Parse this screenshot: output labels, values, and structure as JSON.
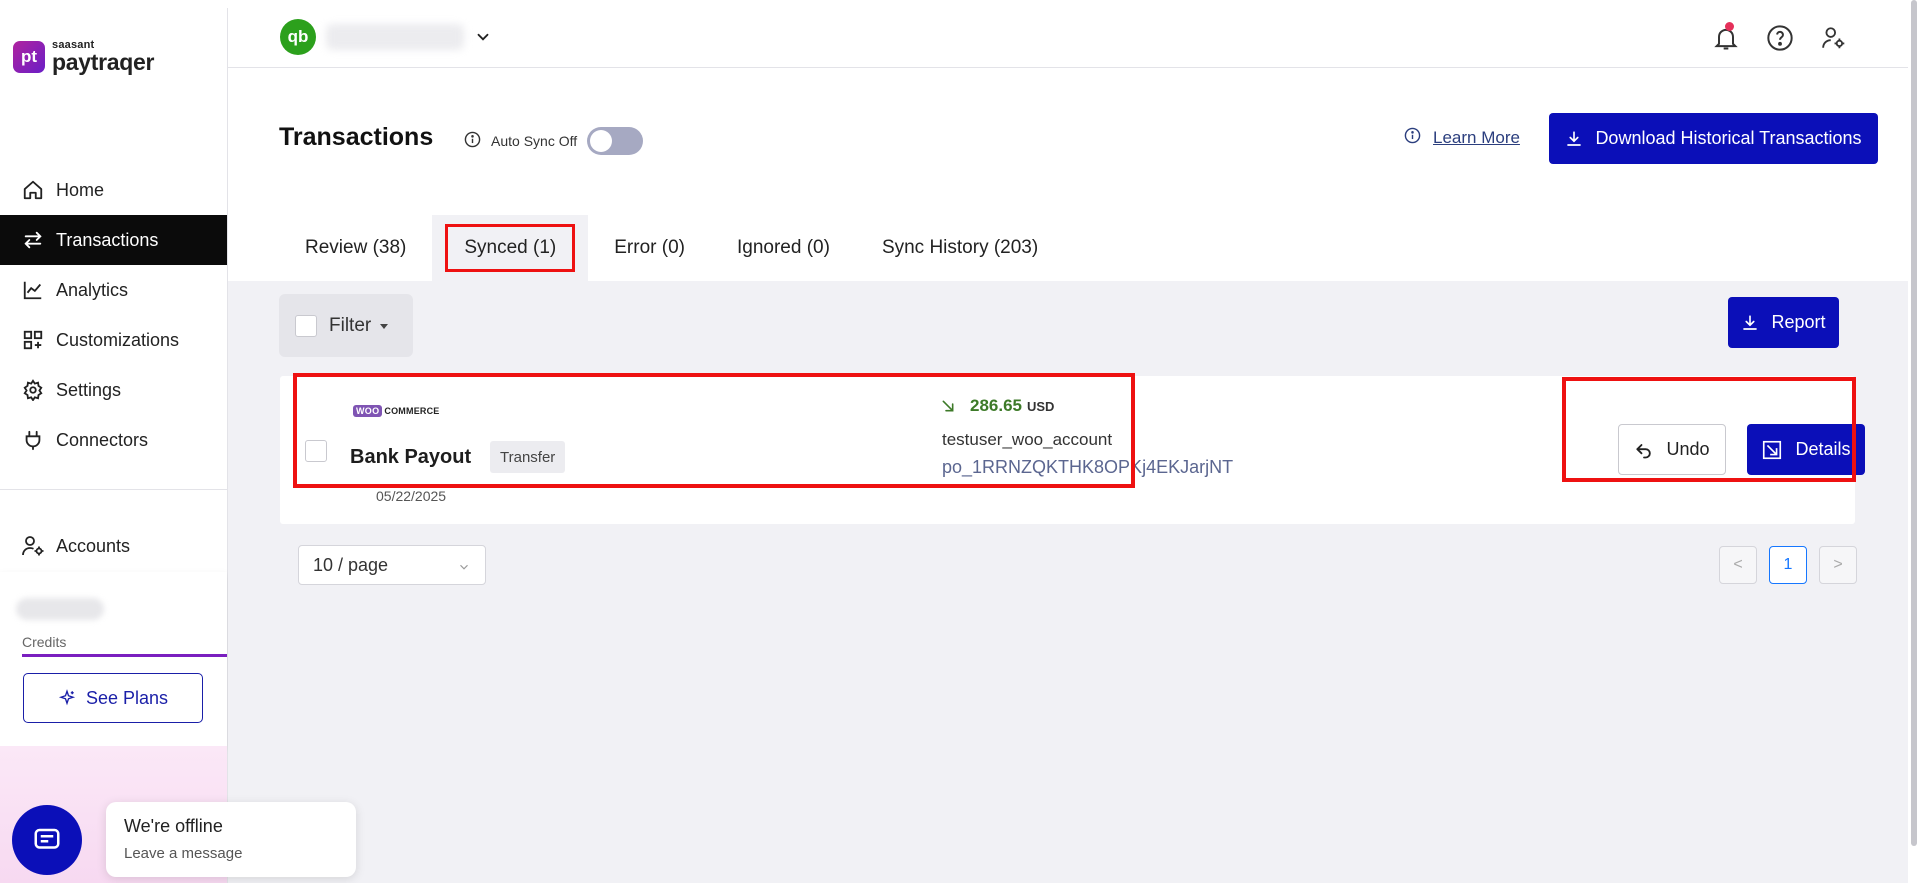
{
  "brand": {
    "mark": "pt",
    "sub": "saasant",
    "name": "paytraqer"
  },
  "nav": [
    {
      "label": "Home",
      "icon": "home-icon"
    },
    {
      "label": "Transactions",
      "icon": "transfer-icon",
      "active": true
    },
    {
      "label": "Analytics",
      "icon": "chart-line-icon"
    },
    {
      "label": "Customizations",
      "icon": "grid-plus-icon"
    },
    {
      "label": "Settings",
      "icon": "gear-icon"
    },
    {
      "label": "Connectors",
      "icon": "plug-icon"
    }
  ],
  "accounts": {
    "label": "Accounts",
    "icon": "user-gear-icon"
  },
  "credits": {
    "label": "Credits",
    "see_plans": "See Plans"
  },
  "topbar": {
    "qb_mark": "qb"
  },
  "page": {
    "title": "Transactions",
    "auto_sync_label": "Auto Sync Off",
    "auto_sync_on": false,
    "learn_more": "Learn More",
    "download_hist": "Download Historical Transactions"
  },
  "tabs": [
    {
      "label": "Review (38)"
    },
    {
      "label": "Synced (1)",
      "active": true
    },
    {
      "label": "Error (0)"
    },
    {
      "label": "Ignored (0)"
    },
    {
      "label": "Sync History (203)"
    }
  ],
  "toolbar": {
    "filter": "Filter",
    "report": "Report"
  },
  "transaction": {
    "source_logo": {
      "part1": "WOO",
      "part2": "COMMERCE"
    },
    "name": "Bank Payout",
    "type": "Transfer",
    "date": "05/22/2025",
    "amount": "286.65",
    "currency": "USD",
    "account": "testuser_woo_account",
    "reference": "po_1RRNZQKTHK8OPKj4EKJarjNT",
    "undo": "Undo",
    "details": "Details"
  },
  "pagination": {
    "page_size": "10 / page",
    "prev": "<",
    "current": "1",
    "next": ">"
  },
  "chat": {
    "status": "We're offline",
    "sub": "Leave a message"
  },
  "colors": {
    "primary": "#0b0fb8",
    "active_nav": "#0b0fb8",
    "amount_green": "#3d7a28",
    "highlight": "#ee1111"
  }
}
